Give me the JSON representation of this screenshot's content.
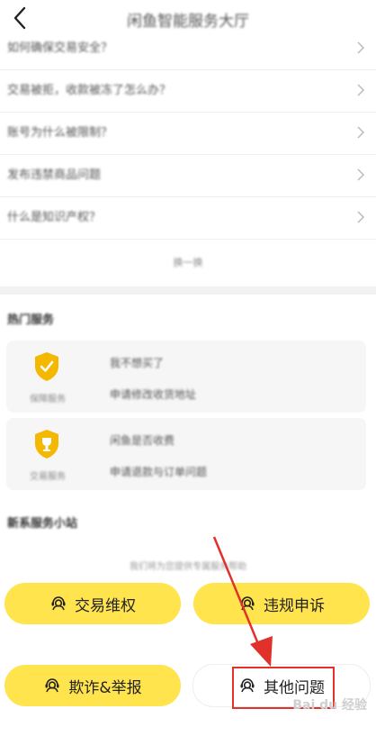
{
  "header": {
    "title": "闲鱼智能服务大厅",
    "back_icon": "chevron-left-icon"
  },
  "faq": {
    "items": [
      {
        "label": "如何确保交易安全？"
      },
      {
        "label": "交易被拒，收款被冻了怎么办？"
      },
      {
        "label": "账号为什么被限制？"
      },
      {
        "label": "发布违禁商品问题"
      },
      {
        "label": "什么是知识产权？"
      }
    ],
    "more_label": "换一换"
  },
  "hot_services": {
    "title": "热门服务",
    "cards": [
      {
        "label": "保障服务",
        "lines": [
          "我不想买了",
          "申请修改收货地址"
        ],
        "icon": "shield-icon"
      },
      {
        "label": "交易服务",
        "lines": [
          "闲鱼是否收费",
          "申请退款与订单问题"
        ],
        "icon": "trophy-shield-icon"
      }
    ]
  },
  "service_center": {
    "title": "新系服务小站",
    "hint": "我们将为您提供专属服务帮助",
    "buttons": [
      {
        "label": "交易维权",
        "style": "yellow",
        "icon": "support-agent-icon"
      },
      {
        "label": "违规申诉",
        "style": "yellow",
        "icon": "support-agent-icon"
      },
      {
        "label": "欺诈&举报",
        "style": "yellow",
        "icon": "support-agent-icon"
      },
      {
        "label": "其他问题",
        "style": "white",
        "icon": "support-agent-icon"
      }
    ]
  },
  "watermark": "Bai du 经验",
  "colors": {
    "accent": "#ffe44d",
    "highlight": "#e0312b",
    "divider": "#f2f2f2",
    "card": "#f6f6f6",
    "shield": "#f5b800"
  }
}
